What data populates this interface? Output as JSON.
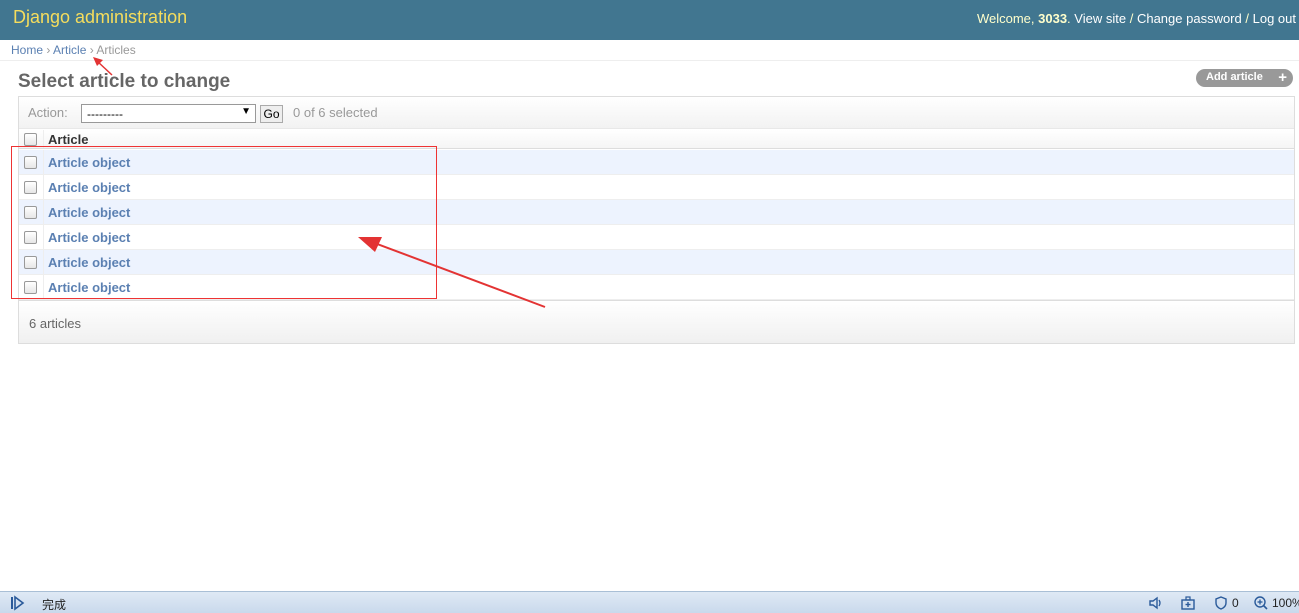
{
  "header": {
    "title": "Django administration",
    "welcome": "Welcome,",
    "username": "3033",
    "view_site": "View site",
    "change_password": "Change password",
    "log_out": "Log out",
    "sep": "/"
  },
  "breadcrumbs": {
    "home": "Home",
    "app": "Article",
    "current": "Articles",
    "sep": "›"
  },
  "page": {
    "title": "Select article to change",
    "add_button": "Add article"
  },
  "actions": {
    "label": "Action:",
    "selected": "---------",
    "go": "Go",
    "counter": "0 of 6 selected"
  },
  "table": {
    "column": "Article",
    "rows": [
      "Article object",
      "Article object",
      "Article object",
      "Article object",
      "Article object",
      "Article object"
    ]
  },
  "paginator": {
    "count": "6 articles"
  },
  "statusbar": {
    "status": "完成",
    "shield_count": "0",
    "zoom": "100%"
  },
  "colors": {
    "header_bg": "#417690",
    "branding": "#f5dd5d",
    "link": "#5b80b2",
    "row_alt": "#edf3fe",
    "annotation": "#e33333"
  }
}
